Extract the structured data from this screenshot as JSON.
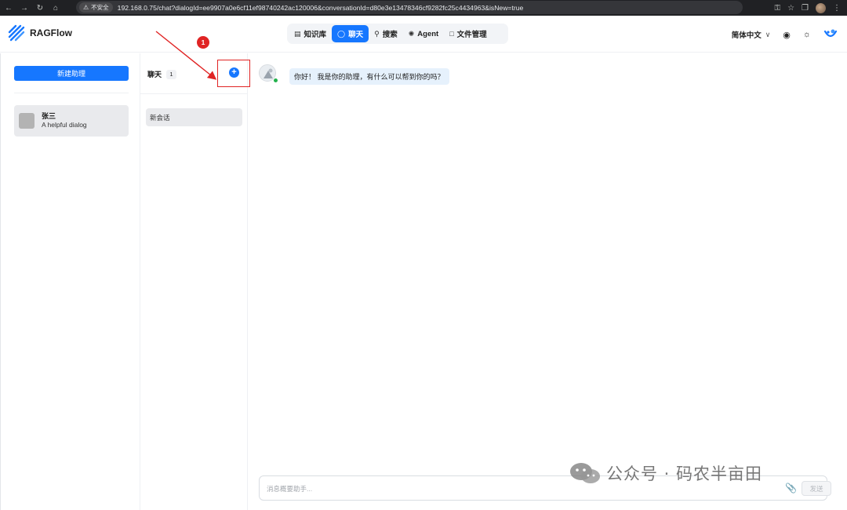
{
  "browser": {
    "insecure_label": "不安全",
    "url": "192.168.0.75/chat?dialogId=ee9907a0e6cf11ef98740242ac120006&conversationId=d80e3e13478346cf9282fc25c4434963&isNew=true"
  },
  "app": {
    "name": "RAGFlow",
    "brand_color": "#1677ff"
  },
  "nav": {
    "items": [
      {
        "label": "知识库",
        "icon": "database-icon"
      },
      {
        "label": "聊天",
        "icon": "chat-bubble-icon",
        "active": true
      },
      {
        "label": "搜索",
        "icon": "search-icon"
      },
      {
        "label": "Agent",
        "icon": "agent-graph-icon"
      },
      {
        "label": "文件管理",
        "icon": "folder-icon"
      }
    ]
  },
  "header": {
    "language": "简体中文"
  },
  "left": {
    "new_assistant_label": "新建助理",
    "assistants": [
      {
        "name": "张三",
        "description": "A helpful dialog"
      }
    ]
  },
  "middle": {
    "title": "聊天",
    "count": "1",
    "add_symbol": "+",
    "conversations": [
      {
        "label": "新会话"
      }
    ]
  },
  "chat": {
    "greeting": "你好！ 我是你的助理，有什么可以帮到你的吗？",
    "input_placeholder": "消息概要助手...",
    "send_label": "发送"
  },
  "annotation": {
    "step_number": "1",
    "color": "#e02424"
  },
  "watermark": {
    "text": "公众号 · 码农半亩田"
  }
}
